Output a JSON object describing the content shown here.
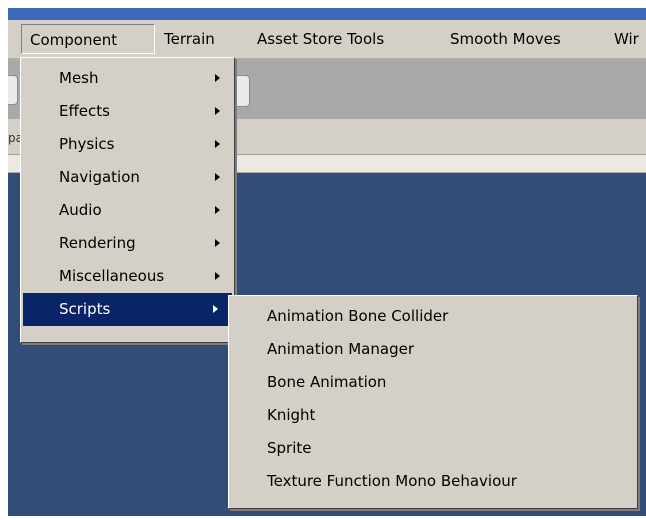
{
  "menubar": {
    "items": [
      "Component",
      "Terrain",
      "Asset Store Tools",
      "Smooth Moves",
      "Wir"
    ]
  },
  "tabstrip": {
    "partial_label": "pa"
  },
  "component_menu": {
    "items": [
      {
        "label": "Mesh"
      },
      {
        "label": "Effects"
      },
      {
        "label": "Physics"
      },
      {
        "label": "Navigation"
      },
      {
        "label": "Audio"
      },
      {
        "label": "Rendering"
      },
      {
        "label": "Miscellaneous"
      },
      {
        "label": "Scripts"
      }
    ],
    "selected_label": "Scripts"
  },
  "scripts_submenu": {
    "items": [
      {
        "label": "Animation Bone Collider"
      },
      {
        "label": "Animation Manager"
      },
      {
        "label": "Bone Animation"
      },
      {
        "label": "Knight"
      },
      {
        "label": "Sprite"
      },
      {
        "label": "Texture Function Mono Behaviour"
      }
    ]
  },
  "colors": {
    "menu_background": "#d4d0c8",
    "selection": "#0a246a",
    "workspace": "#324e78",
    "title_strip": "#3d6ab8",
    "toolbar": "#a9a9a9"
  },
  "icons": {
    "submenu_arrow": "triangle-right-icon"
  }
}
